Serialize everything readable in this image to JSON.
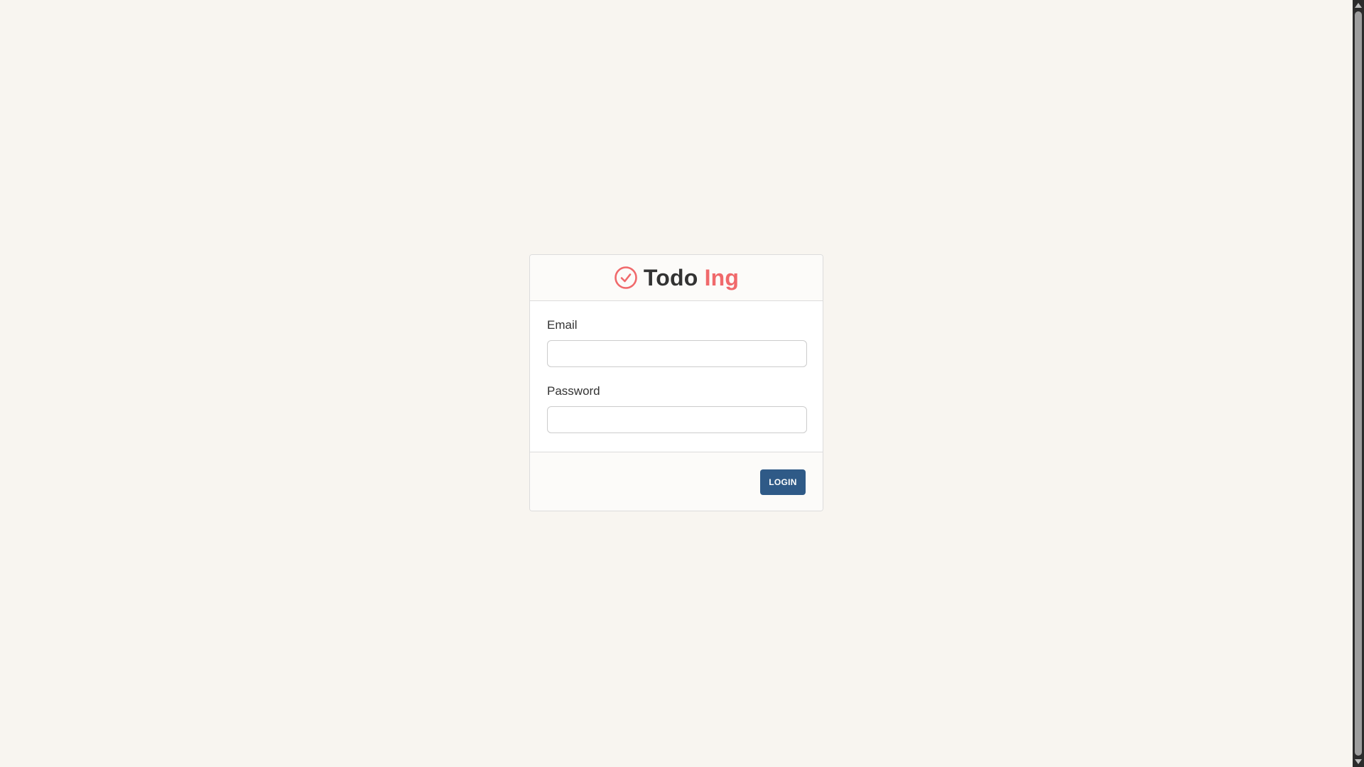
{
  "brand": {
    "name_main": "Todo",
    "name_accent": "Ing",
    "icon": "check-circle-icon",
    "accent_color": "#f0696b"
  },
  "form": {
    "email_label": "Email",
    "email_value": "",
    "password_label": "Password",
    "password_value": "",
    "login_label": "LOGIN"
  },
  "colors": {
    "background": "#f8f5f0",
    "button": "#2f5a87"
  }
}
